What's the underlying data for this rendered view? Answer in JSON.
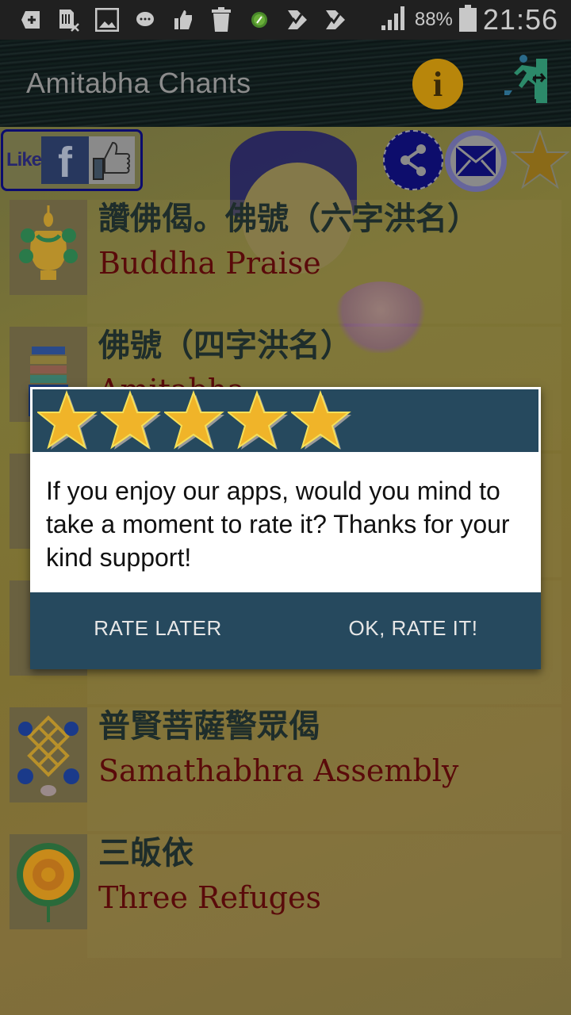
{
  "status_bar": {
    "icons": [
      "add-icon",
      "sim-error-icon",
      "gallery-icon",
      "chat-icon",
      "thumbs-up-icon",
      "trash-icon",
      "green-app-icon",
      "check-flag-icon",
      "check-flag-icon"
    ],
    "battery": "88%",
    "time": "21:56"
  },
  "app_bar": {
    "title": "Amitabha Chants",
    "info_icon": "info-icon",
    "exit_icon": "exit-icon"
  },
  "share_bar": {
    "like_label": "Like",
    "facebook_glyph": "f",
    "share_icon": "share-icon",
    "mail_icon": "mail-icon",
    "favorite_icon": "star-icon"
  },
  "list": {
    "items": [
      {
        "zh": "讚佛偈。佛號（六字洪名）",
        "en": "Buddha Praise",
        "icon": "treasure-vase-icon"
      },
      {
        "zh": "佛號（四字洪名）",
        "en": "Amitabha",
        "icon": "victory-banner-icon"
      },
      {
        "zh": "",
        "en": "",
        "icon": "conch-icon"
      },
      {
        "zh": "",
        "en": "",
        "icon": "lotus-icon"
      },
      {
        "zh": "普賢菩薩警眾偈",
        "en": "Samathabhra Assembly",
        "icon": "endless-knot-icon"
      },
      {
        "zh": "三皈依",
        "en": "Three Refuges",
        "icon": "flower-icon"
      }
    ]
  },
  "dialog": {
    "rating_stars": 5,
    "message": "If you enjoy our apps, would you mind to take a moment to rate it? Thanks for your kind support!",
    "rate_later": "RATE LATER",
    "rate_now": "OK, RATE IT!"
  },
  "colors": {
    "dialog_header": "#26495e",
    "star_fill": "#f0b429",
    "title_text": "#8c8c8c"
  }
}
